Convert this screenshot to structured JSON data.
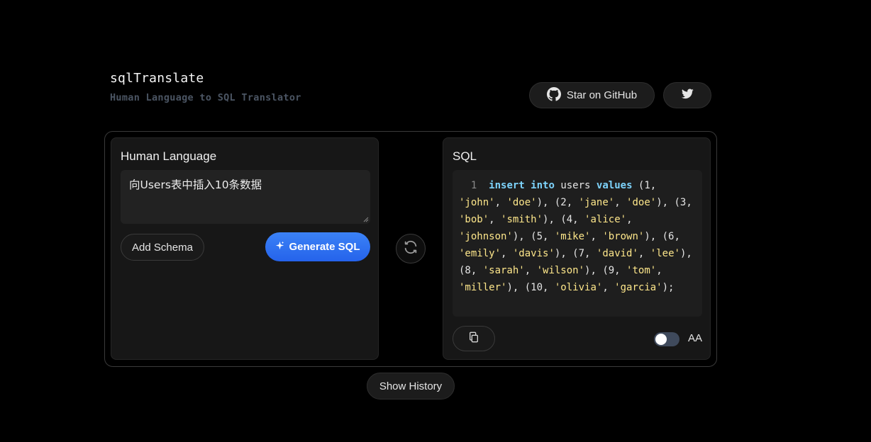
{
  "header": {
    "title": "sqlTranslate",
    "subtitle": "Human Language to SQL Translator"
  },
  "top_actions": {
    "github_label": "Star on GitHub",
    "github_icon": "github-icon",
    "twitter_icon": "twitter-icon"
  },
  "left_panel": {
    "title": "Human Language",
    "input_value": "向Users表中插入10条数据",
    "add_schema_label": "Add Schema",
    "generate_label": "Generate SQL",
    "generate_icon": "sparkles-icon"
  },
  "swap_icon": "swap-icon",
  "right_panel": {
    "title": "SQL",
    "line_number": "1",
    "sql_output": "insert into users values (1, 'john', 'doe'), (2, 'jane', 'doe'), (3, 'bob', 'smith'), (4, 'alice', 'johnson'), (5, 'mike', 'brown'), (6, 'emily', 'davis'), (7, 'david', 'lee'), (8, 'sarah', 'wilson'), (9, 'tom', 'miller'), (10, 'olivia', 'garcia');",
    "copy_icon": "copy-icon",
    "toggle_on": false,
    "aa_label": "AA"
  },
  "footer": {
    "history_label": "Show History"
  },
  "colors": {
    "accent": "#2563eb",
    "sql_keyword": "#7dd3fc",
    "sql_string": "#fde68a"
  }
}
